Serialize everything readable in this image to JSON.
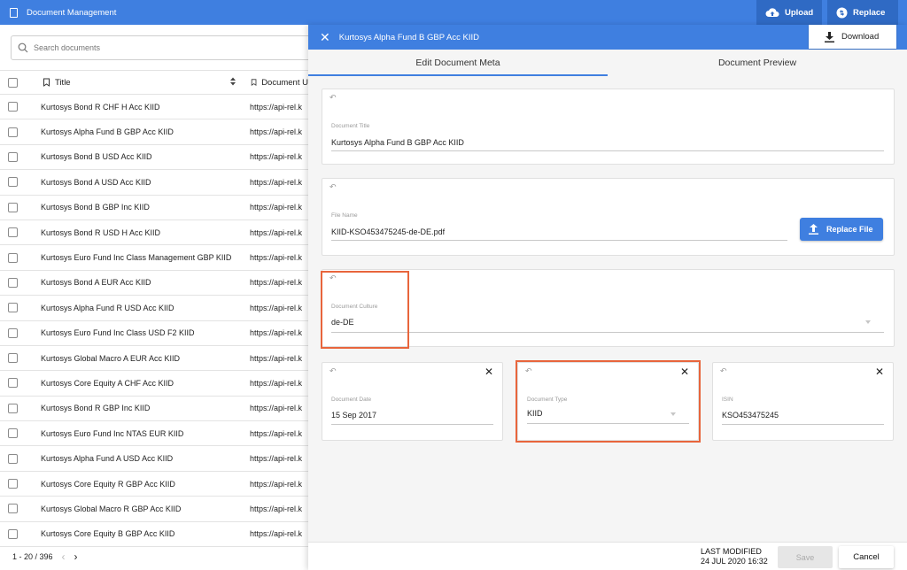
{
  "app": {
    "title": "Document Management",
    "upload_label": "Upload",
    "replace_label": "Replace",
    "accent": "#3f7fe0"
  },
  "search": {
    "placeholder": "Search documents"
  },
  "table": {
    "columns": [
      "Title",
      "Document U"
    ],
    "rows": [
      {
        "title": "Kurtosys Bond R CHF H Acc KIID",
        "url": "https://api-rel.k"
      },
      {
        "title": "Kurtosys Alpha Fund B GBP Acc KIID",
        "url": "https://api-rel.k"
      },
      {
        "title": "Kurtosys Bond B USD Acc KIID",
        "url": "https://api-rel.k"
      },
      {
        "title": "Kurtosys Bond A USD Acc KIID",
        "url": "https://api-rel.k"
      },
      {
        "title": "Kurtosys Bond B GBP Inc KIID",
        "url": "https://api-rel.k"
      },
      {
        "title": "Kurtosys Bond R USD H Acc KIID",
        "url": "https://api-rel.k"
      },
      {
        "title": "Kurtosys Euro Fund Inc Class Management GBP KIID",
        "url": "https://api-rel.k"
      },
      {
        "title": "Kurtosys Bond A EUR Acc KIID",
        "url": "https://api-rel.k"
      },
      {
        "title": "Kurtosys Alpha Fund R USD Acc KIID",
        "url": "https://api-rel.k"
      },
      {
        "title": "Kurtosys Euro Fund Inc Class USD F2 KIID",
        "url": "https://api-rel.k"
      },
      {
        "title": "Kurtosys Global Macro A EUR Acc KIID",
        "url": "https://api-rel.k"
      },
      {
        "title": "Kurtosys Core Equity A CHF Acc KIID",
        "url": "https://api-rel.k"
      },
      {
        "title": "Kurtosys Bond R GBP Inc KIID",
        "url": "https://api-rel.k"
      },
      {
        "title": "Kurtosys Euro Fund Inc NTAS EUR KIID",
        "url": "https://api-rel.k"
      },
      {
        "title": "Kurtosys Alpha Fund A USD Acc KIID",
        "url": "https://api-rel.k"
      },
      {
        "title": "Kurtosys Core Equity R GBP Acc KIID",
        "url": "https://api-rel.k"
      },
      {
        "title": "Kurtosys Global Macro R GBP Acc KIID",
        "url": "https://api-rel.k"
      },
      {
        "title": "Kurtosys Core Equity B GBP Acc KIID",
        "url": "https://api-rel.k"
      }
    ]
  },
  "pager": {
    "range": "1 - 20 / 396"
  },
  "panel": {
    "title": "Kurtosys Alpha Fund B GBP Acc KIID",
    "download_label": "Download",
    "tabs": [
      "Edit Document Meta",
      "Document Preview"
    ],
    "fields": {
      "title": {
        "label": "Document Title",
        "value": "Kurtosys Alpha Fund B GBP Acc KIID"
      },
      "file": {
        "label": "File Name",
        "value": "KIID-KSO453475245-de-DE.pdf",
        "button": "Replace File"
      },
      "culture": {
        "label": "Document Culture",
        "value": "de-DE"
      },
      "date": {
        "label": "Document Date",
        "value": "15 Sep 2017"
      },
      "type": {
        "label": "Document Type",
        "value": "KIID"
      },
      "isin": {
        "label": "ISIN",
        "value": "KSO453475245"
      }
    },
    "footer": {
      "last_modified_label": "LAST MODIFIED",
      "last_modified_value": "24 JUL 2020 16:32",
      "save_label": "Save",
      "cancel_label": "Cancel"
    },
    "highlight_color": "#e8653c"
  }
}
